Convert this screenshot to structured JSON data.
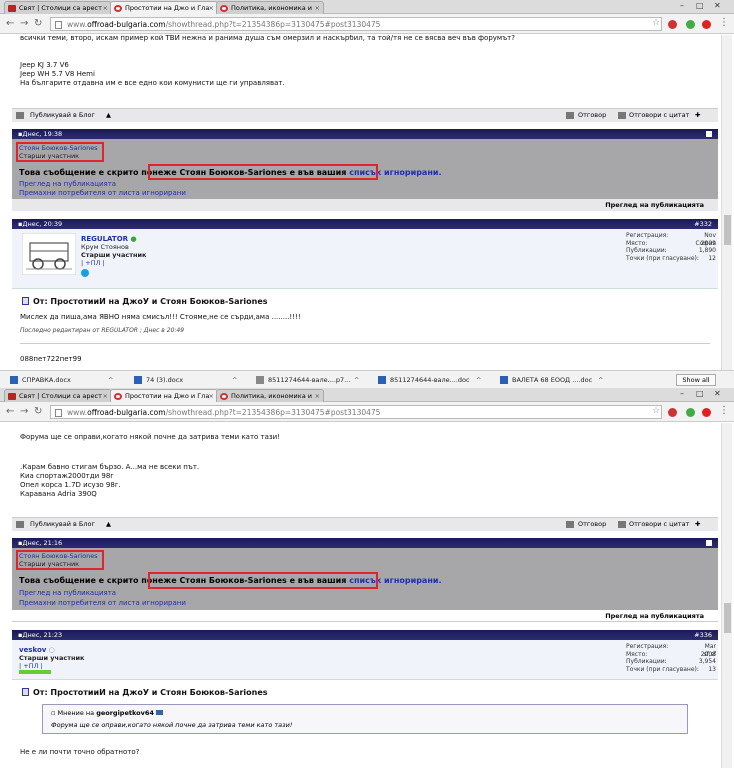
{
  "top": {
    "tabs": [
      {
        "label": "Свят | Столици са арест"
      },
      {
        "label": "Простотии на Джо и Гла"
      },
      {
        "label": "Политика, икономика и"
      }
    ],
    "url": {
      "prefix": "www.",
      "domain": "offroad-bulgaria.com",
      "path": "/showthread.php?t=21354386p=3130475#post3130475"
    },
    "text_lines": [
      "всички теми, второ, искам пример кой ТВИ нежна и ранима душа съм омерзил и наскърбил, та той/тя не се вясва веч във форумът?",
      "Jeep KJ 3.7 V6",
      "Jeep WH 5.7 V8 Hemi",
      "На българите отдавна им е все едно кои комунисти ще ги управляват."
    ],
    "footer": {
      "blog": "Публикувай в Блог",
      "reply": "Отговор",
      "reply_quote": "Отговори с цитат"
    },
    "ignored": {
      "date": "Днес, 19:38",
      "name": "Стоян Боюков-Sariones",
      "role": "Старши участник",
      "msg_prefix": "Това съобщение е скрито понеже ",
      "msg_name": "Стоян Боюков-Sariones",
      "msg_mid": " е във вашия ",
      "msg_link": "списък игнорирани.",
      "link1": "Преглед на публикацията",
      "link2": "Премахни потребителя от листа игнорирани",
      "foot": "Преглед на публикацията"
    },
    "post": {
      "date": "Днес,    20:39",
      "num": "#332",
      "user": "REGULATOR",
      "realname": "Крум Стоянов",
      "rank": "Старши участник",
      "rep": "| +ПЛ |",
      "stats": [
        {
          "k": "Регистрация:",
          "v": "Nov 2009"
        },
        {
          "k": "Място:",
          "v": "София"
        },
        {
          "k": "Публикации:",
          "v": "1,890"
        },
        {
          "k": "Точки (при гласуване):",
          "v": "12"
        }
      ],
      "title": "От: ПростотииИ на ДжоУ и Стоян Боюков-Sariones",
      "body": "Мислех да пиша,ама ЯВНО няма смисъл!!! Стояме,не се сърди,ама ........!!!!",
      "edited": "Последно редактиран от REGULATOR ; Днес в 20:49",
      "sig": "088пет722пет99"
    },
    "downloads": [
      {
        "label": "СПРАВКА.docx"
      },
      {
        "label": "74 (3).docx"
      },
      {
        "label": "8511274644-вале....p7..."
      },
      {
        "label": "8511274644-вале....doc"
      },
      {
        "label": "ВАЛЕТА 68 ЕООД ....doc"
      }
    ],
    "show_all": "Show all"
  },
  "bottom": {
    "tabs": [
      {
        "label": "Свят | Столици са арест"
      },
      {
        "label": "Простотии на Джо и Гла"
      },
      {
        "label": "Политика, икономика и"
      }
    ],
    "url": {
      "prefix": "www.",
      "domain": "offroad-bulgaria.com",
      "path": "/showthread.php?t=21354386p=3130475#post3130475"
    },
    "text_lines": [
      "Форума ще се оправи,когато някой почне да затрива теми като тази!",
      ".Карам бавно стигам бързо. А...ма не всеки път.",
      "Киа спортаж2000тди 98г",
      "Опел корса 1.7D исузо 98г.",
      "Каравана Adria 390Q"
    ],
    "footer": {
      "blog": "Публикувай в Блог",
      "reply": "Отговор",
      "reply_quote": "Отговори с цитат"
    },
    "ignored": {
      "date": "Днес, 21:16",
      "name": "Стоян Боюков-Sariones",
      "role": "Старши участник",
      "msg_prefix": "Това съобщение е скрито понеже ",
      "msg_name": "Стоян Боюков-Sariones",
      "msg_mid": " е във вашия ",
      "msg_link": "списък игнорирани.",
      "link1": "Преглед на публикацията",
      "link2": "Премахни потребителя от листа игнорирани",
      "foot": "Преглед на публикацията"
    },
    "post": {
      "date": "Днес,    21:23",
      "num": "#336",
      "user": "veskov",
      "rank": "Старши участник",
      "rep": "| +ПЛ |",
      "stats": [
        {
          "k": "Регистрация:",
          "v": "Mar 2008"
        },
        {
          "k": "Място:",
          "v": "sf,sf"
        },
        {
          "k": "Публикации:",
          "v": "3,954"
        },
        {
          "k": "Точки (при гласуване):",
          "v": "13"
        }
      ],
      "title": "От: ПростотииИ на ДжоУ и Стоян Боюков-Sariones",
      "quote_prefix": "Мнение на ",
      "quote_author": "georgipetkov64",
      "quote_text": "Форума ще се оправи,когато някой почне да затрива теми като тази!",
      "body": "Не е ли почти точно обратното?"
    }
  }
}
